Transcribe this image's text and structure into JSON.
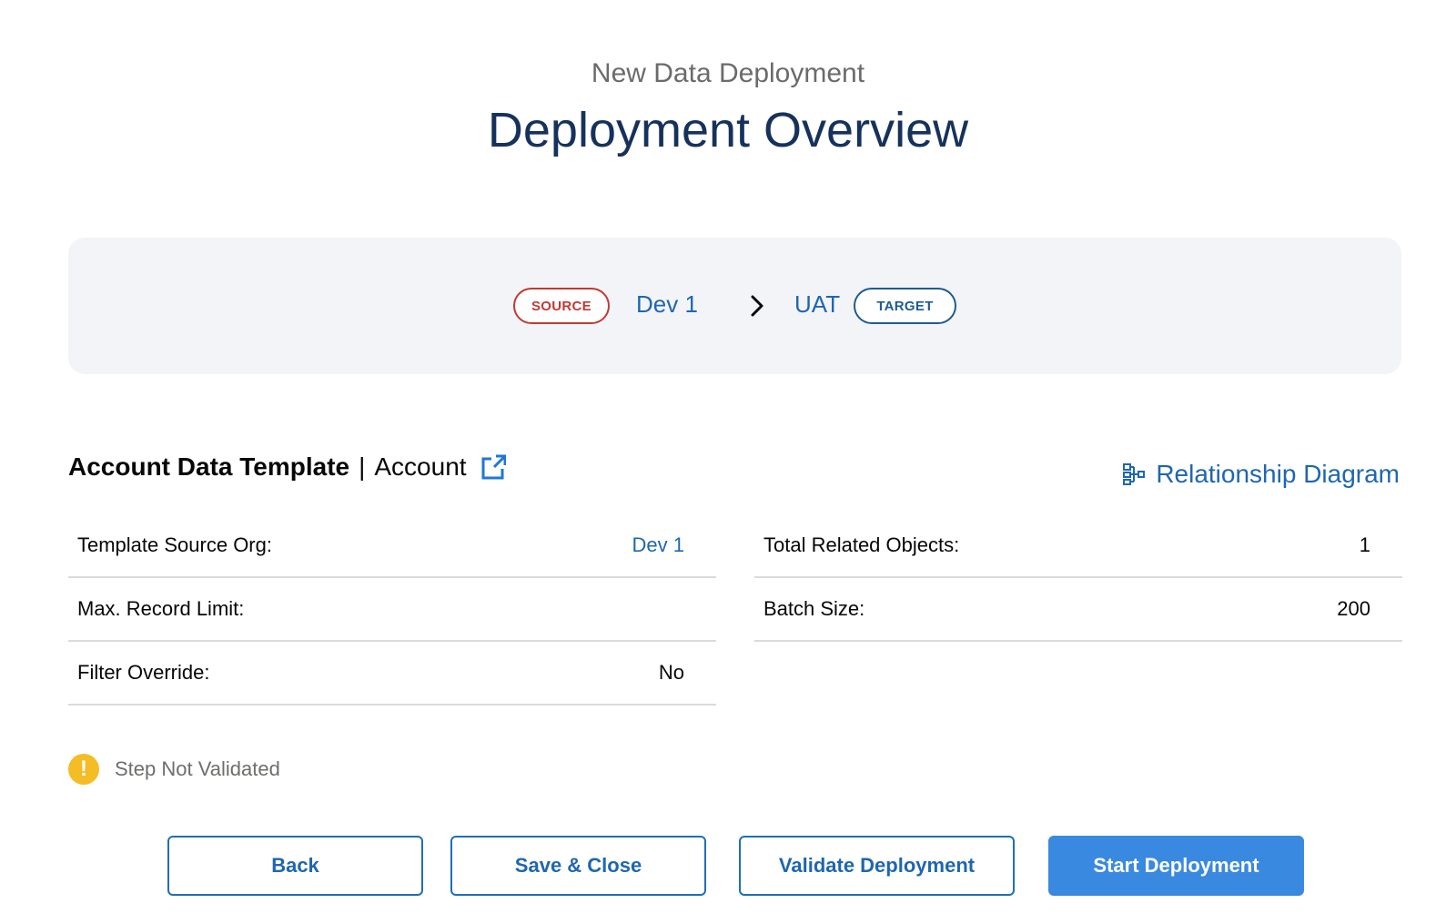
{
  "header": {
    "subtitle": "New Data Deployment",
    "title": "Deployment Overview"
  },
  "route": {
    "source_badge": "SOURCE",
    "source_org": "Dev 1",
    "target_org": "UAT",
    "target_badge": "TARGET"
  },
  "template": {
    "name": "Account Data Template",
    "separator": "|",
    "object": "Account",
    "relationship_link": "Relationship Diagram"
  },
  "details": {
    "left": [
      {
        "label": "Template Source Org:",
        "value": "Dev 1"
      },
      {
        "label": "Max. Record Limit:",
        "value": ""
      },
      {
        "label": "Filter Override:",
        "value": "No"
      }
    ],
    "right": [
      {
        "label": "Total Related Objects:",
        "value": "1"
      },
      {
        "label": "Batch Size:",
        "value": "200"
      }
    ]
  },
  "status": {
    "icon": "warning-icon",
    "text": "Step Not Validated"
  },
  "buttons": {
    "back": "Back",
    "save_close": "Save & Close",
    "validate": "Validate Deployment",
    "start": "Start Deployment"
  },
  "colors": {
    "source_red": "#c23934",
    "target_blue": "#1f5b90",
    "link_blue": "#1f66b1",
    "primary_button": "#3a89e0",
    "warning_yellow": "#f4bc25",
    "title_navy": "#16325c"
  }
}
